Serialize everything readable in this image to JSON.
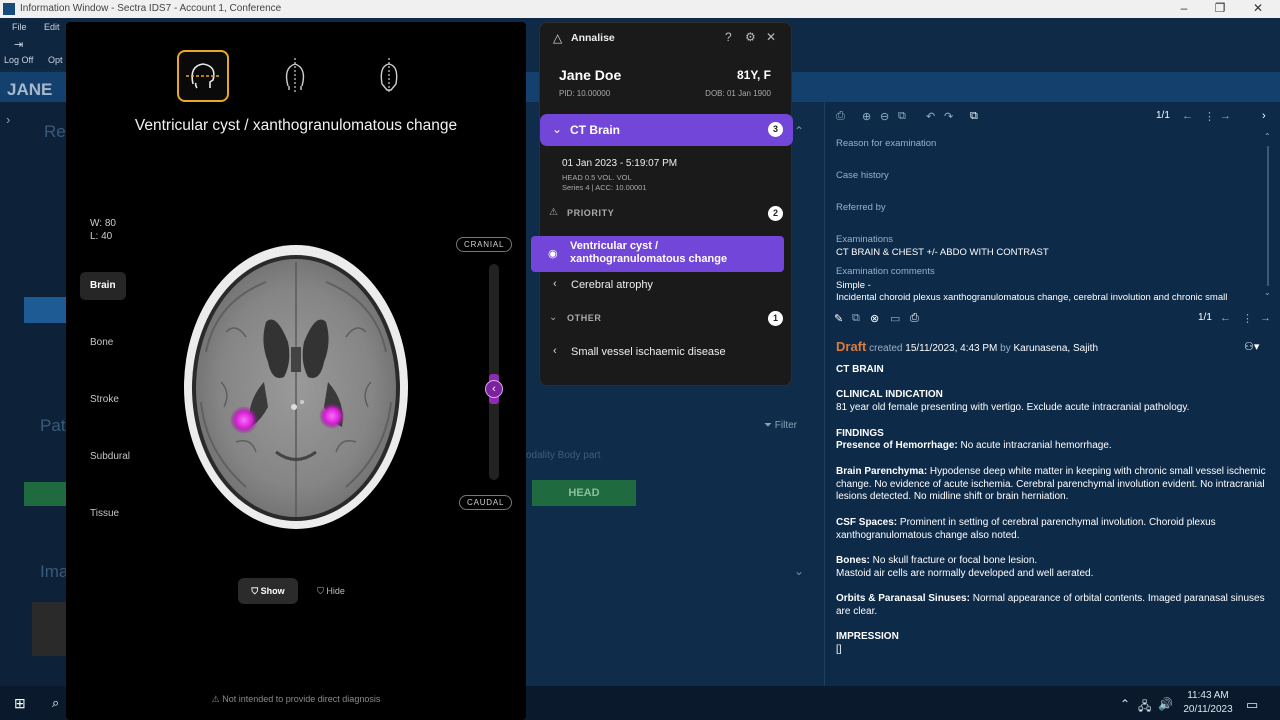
{
  "window": {
    "title": "Information Window - Sectra IDS7 - Account 1, Conference",
    "min": "–",
    "max": "❐",
    "close": "✕"
  },
  "pacs": {
    "menu": [
      "File",
      "Edit"
    ],
    "logoff": "Log Off",
    "opt": "Opt",
    "patient_short": "JANE",
    "left_frag": [
      "Re",
      "Pat",
      "Ima"
    ],
    "filter_label": "Filter",
    "table_hdr": "odality Body part",
    "head_cell": "HEAD"
  },
  "viewer": {
    "title": "Ventricular cyst / xanthogranulomatous change",
    "w": "W: 80",
    "l": "L: 40",
    "windows": [
      "Brain",
      "Bone",
      "Stroke",
      "Subdural",
      "Tissue"
    ],
    "active_window": "Brain",
    "slider_top": "CRANIAL",
    "slider_bottom": "CAUDAL",
    "slice_position": 0.62,
    "show": "Show",
    "hide": "Hide",
    "disclaimer": "Not intended to provide direct diagnosis"
  },
  "annalise": {
    "name": "Annalise",
    "patient_name": "Jane Doe",
    "age_sex": "81Y, F",
    "pid": "PID: 10.00000",
    "dob": "DOB: 01 Jan 1900",
    "study": "CT Brain",
    "study_count": "3",
    "study_date": "01 Jan 2023 - 5:19:07 PM",
    "study_info1": "HEAD 0.5 VOL. VOL",
    "study_info2": "Series 4  |  ACC: 10.00001",
    "priority_label": "PRIORITY",
    "priority_count": "2",
    "findings_priority": [
      "Ventricular cyst / xanthogranulomatous change",
      "Cerebral atrophy"
    ],
    "other_label": "OTHER",
    "other_count": "1",
    "findings_other": [
      "Small vessel ischaemic disease"
    ],
    "accent": "#7246d8"
  },
  "report": {
    "page_top": "1/1",
    "reason": "Reason for examination",
    "case_history": "Case history",
    "referred": "Referred by",
    "examinations_label": "Examinations",
    "examinations": "CT BRAIN & CHEST  +/- ABDO WITH CONTRAST",
    "exam_comments_label": "Examination comments",
    "exam_comments1": "Simple -",
    "exam_comments2": "Incidental choroid plexus xanthogranulomatous change, cerebral involution and chronic small",
    "page_bottom": "1/1",
    "draft": "Draft",
    "created": "created",
    "created_date": "15/11/2023, 4:43 PM",
    "by": "by",
    "author": "Karunasena, Sajith",
    "heading": "CT BRAIN",
    "ci_title": "CLINICAL INDICATION",
    "ci": "81 year old female presenting with vertigo. Exclude acute intracranial pathology.",
    "findings_title": "FINDINGS",
    "hem_label": "Presence of Hemorrhage:",
    "hem": " No acute intracranial hemorrhage.",
    "par_label": "Brain Parenchyma:",
    "par": " Hypodense deep white matter in keeping with chronic small vessel ischemic change. No evidence of acute ischemia. Cerebral parenchymal involution evident. No intracranial lesions detected. No midline shift or brain herniation.",
    "csf_label": "CSF Spaces:",
    "csf": "  Prominent in setting of cerebral parenchymal involution. Choroid plexus xanthogranulomatous change also noted.",
    "bones_label": "Bones:",
    "bones1": " No skull fracture or focal bone lesion.",
    "bones2": "Mastoid air cells are normally developed and well aerated.",
    "orbits_label": "Orbits & Paranasal Sinuses:",
    "orbits": " Normal appearance of orbital contents. Imaged paranasal sinuses are clear.",
    "impression_title": "IMPRESSION",
    "impression": "[]"
  },
  "taskbar": {
    "time": "11:43 AM",
    "date": "20/11/2023"
  }
}
